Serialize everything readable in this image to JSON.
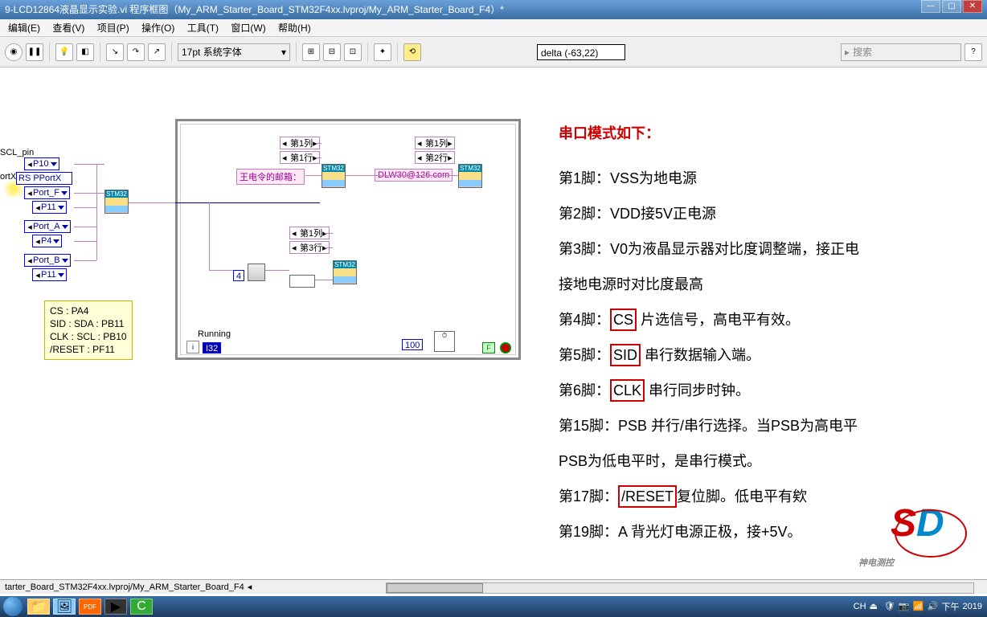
{
  "title": "9-LCD12864液晶显示实验.vi 程序框图（My_ARM_Starter_Board_STM32F4xx.lvproj/My_ARM_Starter_Board_F4）*",
  "menu": {
    "edit": "编辑(E)",
    "view": "查看(V)",
    "project": "项目(P)",
    "operate": "操作(O)",
    "tools": "工具(T)",
    "window": "窗口(W)",
    "help": "帮助(H)"
  },
  "toolbar": {
    "font": "17pt 系统字体",
    "delta": "delta (-63,22)",
    "search_ph": "搜索"
  },
  "diagram": {
    "lbl_scl": "SCL_pin",
    "lbl_portx": "ortX",
    "ports": {
      "p10": "P10",
      "rspp": "RS PPortX",
      "port_f": "Port_F",
      "p11a": "P11",
      "port_a": "Port_A",
      "p4": "P4",
      "port_b": "Port_B",
      "p11b": "P11"
    },
    "columns": {
      "c1a": "第1列",
      "r1a": "第1行",
      "c1b": "第1列",
      "r2": "第2行",
      "c1c": "第1列",
      "r3": "第3行"
    },
    "strings": {
      "email_lbl": "王电令的邮箱：",
      "email": "DLW30@126.com"
    },
    "nodes": {
      "stm32": "STM32"
    },
    "const4": "4",
    "const100": "100",
    "running": "Running",
    "i32": "I32",
    "bool_f": "F"
  },
  "comment": {
    "l1": "CS : PA4",
    "l2": "SID : SDA : PB11",
    "l3": "CLK : SCL : PB10",
    "l4": "/RESET : PF11"
  },
  "doc": {
    "title": "串口模式如下：",
    "p1": "第1脚：VSS为地电源",
    "p2": "第2脚：VDD接5V正电源",
    "p3": "第3脚：V0为液晶显示器对比度调整端，接正电",
    "p3b": "接地电源时对比度最高",
    "p4_pre": "第4脚：",
    "p4_box": "CS",
    "p4_post": "  片选信号，高电平有效。",
    "p5_pre": "第5脚：",
    "p5_box": "SID",
    "p5_post": "  串行数据输入端。",
    "p6_pre": "第6脚：",
    "p6_box": "CLK",
    "p6_post": "  串行同步时钟。",
    "p15": "第15脚：PSB  并行/串行选择。当PSB为高电平",
    "p15b": "PSB为低电平时，是串行模式。",
    "p17_pre": "第17脚：",
    "p17_box": "/RESET",
    "p17_post": "复位脚。低电平有欸",
    "p19": "第19脚：A  背光灯电源正极，接+5V。"
  },
  "status": {
    "path": "tarter_Board_STM32F4xx.lvproj/My_ARM_Starter_Board_F4"
  },
  "taskbar": {
    "ime": "CH",
    "time": "下午",
    "date": "2019"
  },
  "watermark": "神电测控"
}
